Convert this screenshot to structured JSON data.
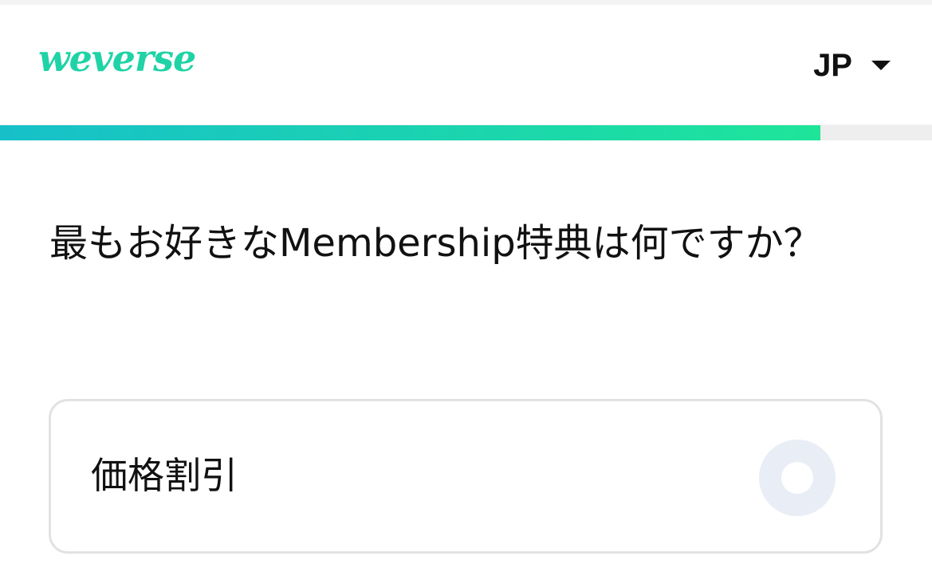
{
  "header": {
    "logo_text": "weverse",
    "language": "JP"
  },
  "progress": {
    "fraction": 0.88,
    "fill_start_color": "#17c0c9",
    "fill_end_color": "#1ee59a"
  },
  "survey": {
    "question": "最もお好きなMembership特典は何ですか？",
    "options": [
      {
        "label": "価格割引",
        "selected": false
      }
    ]
  },
  "colors": {
    "brand": "#1fd3a6"
  },
  "icons": {
    "language_dropdown": "caret-down-icon",
    "option_radio": "radio-unselected-icon"
  }
}
